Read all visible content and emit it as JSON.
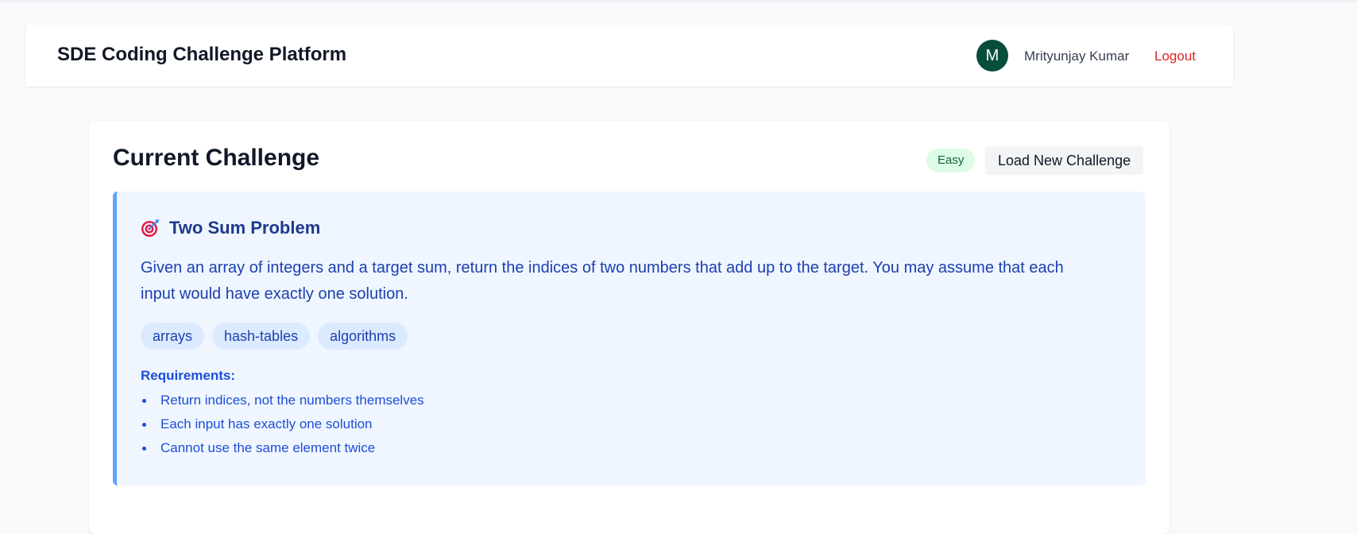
{
  "header": {
    "app_title": "SDE Coding Challenge Platform",
    "avatar_initial": "M",
    "user_name": "Mrityunjay Kumar",
    "logout_label": "Logout"
  },
  "challenge": {
    "section_title": "Current Challenge",
    "difficulty": "Easy",
    "load_button_label": "Load New Challenge",
    "problem": {
      "icon": "target-icon",
      "title": "Two Sum Problem",
      "description": "Given an array of integers and a target sum, return the indices of two numbers that add up to the target. You may assume that each input would have exactly one solution.",
      "tags": [
        "arrays",
        "hash-tables",
        "algorithms"
      ],
      "requirements_label": "Requirements:",
      "requirements": [
        "Return indices, not the numbers themselves",
        "Each input has exactly one solution",
        "Cannot use the same element twice"
      ]
    }
  },
  "colors": {
    "avatar_bg": "#064e3b",
    "logout": "#dc2626",
    "easy_badge_bg": "#dcfce7",
    "problem_bg": "#eff6ff",
    "problem_border": "#60a5fa"
  }
}
